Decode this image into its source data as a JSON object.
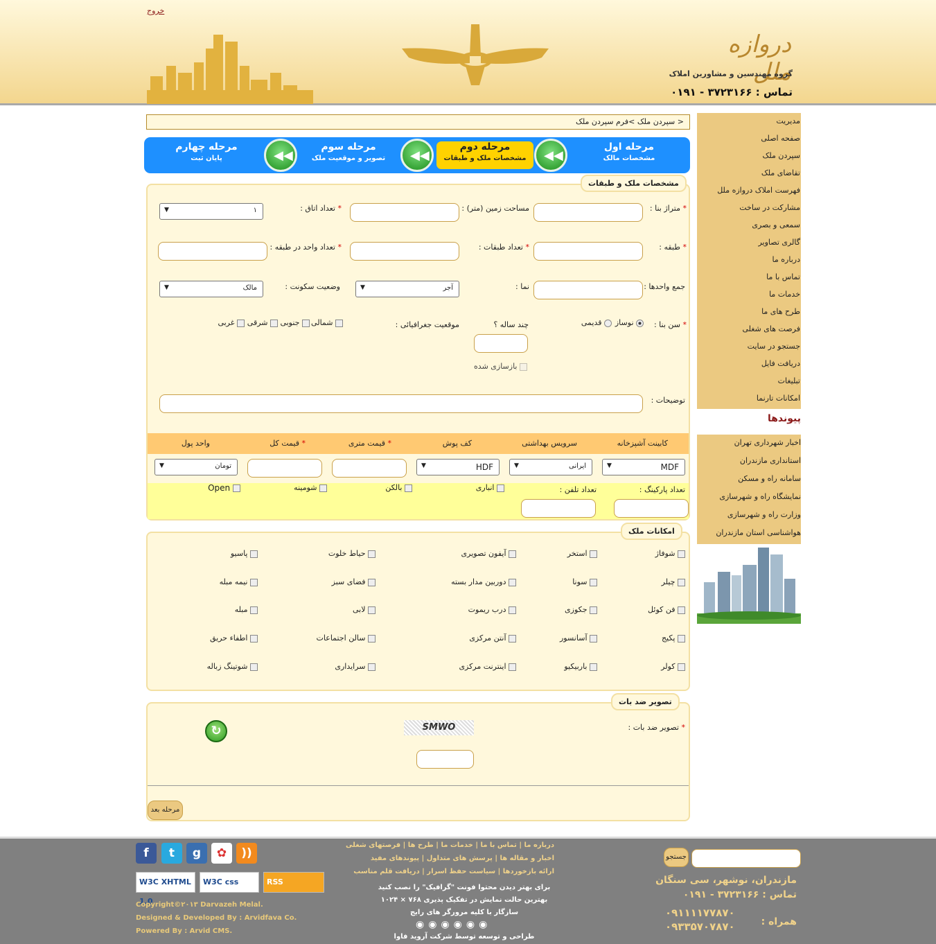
{
  "header": {
    "exit_label": "خروج",
    "logo_title": "دروازه ملل",
    "logo_subtitle": "گروه مهندسین و مشاورین املاک",
    "phone": "تماس : ۳۷۲۳۱۶۶ - ۰۱۹۱"
  },
  "breadcrumb": "< سپردن ملک >فرم سپردن ملک",
  "steps": [
    {
      "title": "مرحله اول",
      "subtitle": "مشخصات مالک"
    },
    {
      "title": "مرحله دوم",
      "subtitle": "مشخصات ملک و طبقات"
    },
    {
      "title": "مرحله سوم",
      "subtitle": "تصویر و موقعیت ملک"
    },
    {
      "title": "مرحله چهارم",
      "subtitle": "پایان ثبت"
    }
  ],
  "specs": {
    "legend": "مشخصات ملک و طبقات",
    "area": "متراژ بنا :",
    "land_area": "مساحت زمین (متر) :",
    "rooms": "تعداد اتاق :",
    "rooms_value": "۱",
    "floor": "طبقه :",
    "floors_count": "تعداد طبقات :",
    "units_per_floor": "تعداد واحد در طبقه :",
    "total_units": "جمع واحدها :",
    "facade": "نما :",
    "facade_value": "آجر",
    "occupancy": "وضعیت سکونت :",
    "occupancy_value": "مالک",
    "age": "سن بنا :",
    "new_opt": "نوساز",
    "old_opt": "قدیمی",
    "years": "چند ساله ؟",
    "location": "موقعیت جغرافیائی :",
    "north": "شمالی",
    "south": "جنوبی",
    "east": "شرقی",
    "west": "غربی",
    "renovated": "بازسازی شده",
    "description": "توضیحات :"
  },
  "price": {
    "headers": [
      "کابینت آشپزخانه",
      "سرویس بهداشتی",
      "کف پوش",
      "قیمت متری",
      "قیمت کل",
      "واحد پول"
    ],
    "cabinet_value": "MDF",
    "wc_value": "ایرانی",
    "floor_value": "HDF",
    "currency_value": "تومان",
    "parking": "تعداد پارکینگ :",
    "phone_count": "تعداد تلفن :",
    "storage": "انباری",
    "balcony": "بالکن",
    "chimney": "شومینه",
    "open": "Open"
  },
  "amenities": {
    "legend": "امکانات ملک",
    "items": [
      "شوفاژ",
      "استخر",
      "آیفون تصویری",
      "حیاط خلوت",
      "پاسیو",
      "چیلر",
      "سونا",
      "دوربین مدار بسته",
      "فضای سبز",
      "نیمه مبله",
      "فن کوئل",
      "جکوزی",
      "درب ریموت",
      "لابی",
      "مبله",
      "پکیج",
      "آسانسور",
      "آنتن مرکزی",
      "سالن اجتماعات",
      "اطفاء حریق",
      "کولر",
      "باربیکیو",
      "اینترنت مرکزی",
      "سرایداری",
      "شوتینگ زباله"
    ]
  },
  "captcha": {
    "legend": "تصویر ضد بات",
    "label": "تصویر ضد بات :",
    "code": "SMWO",
    "next_button": "مرحله بعد"
  },
  "sidebar": {
    "items": [
      "مدیریت",
      "صفحه اصلی",
      "سپردن ملک",
      "تقاضای ملک",
      "فهرست املاک دروازه ملل",
      "مشارکت در ساخت",
      "سمعی و بصری",
      "گالری تصاویر",
      "درباره ما",
      "تماس با ما",
      "خدمات ما",
      "طرح های ما",
      "فرصت های شغلی",
      "جستجو در سایت",
      "دریافت فایل",
      "تبلیغات",
      "امکانات تارنما"
    ],
    "links_title": "پیوندها",
    "links": [
      "اخبار شهرداری تهران",
      "استانداری مازندران",
      "سامانه راه و مسکن",
      "نمایشگاه راه و شهرسازی",
      "وزارت راه و شهرسازی",
      "هواشناسی استان مازندران"
    ]
  },
  "footer": {
    "search_button": "جستجو",
    "address": "مازندران، نوشهر، سی سنگان",
    "phone": "تماس : ۳۷۲۳۱۶۶ - ۰۱۹۱",
    "mobile_label": "همراه :",
    "mobile1": "۰۹۱۱۱۱۷۷۸۷۰",
    "mobile2": "۰۹۳۳۵۷۰۷۸۷۰",
    "links_row1": "درباره ما | تماس با ما | خدمات ما | طرح ها | فرصتهای شغلی",
    "links_row2": "اخبار و مقاله ها | پرسش های متداول | پیوندهای مفید",
    "links_row3": "ارائه بازخوردها | سیاست حفظ اسرار | دریافت قلم مناسب",
    "note1": "برای بهتر دیدن محتوا فونت \"گرافیک\" را نصب کنید",
    "note2": "بهترین حالت نمایش در تفکیک پذیری ۷۶۸ × ۱۰۲۴",
    "note3": "سازگار با کلیه مرورگر های رایج",
    "credit": "طراحی و توسعه توسط شرکت آروید فاوا",
    "copyright": "Copyright©۲۰۱۳ Darvazeh Melal.",
    "designed": "Designed & Developed By : Arvidfava Co.",
    "powered": "Powered By : Arvid CMS.",
    "badge_xhtml": "W3C XHTML 1.0",
    "badge_css": "W3C css",
    "badge_rss": "RSS"
  }
}
